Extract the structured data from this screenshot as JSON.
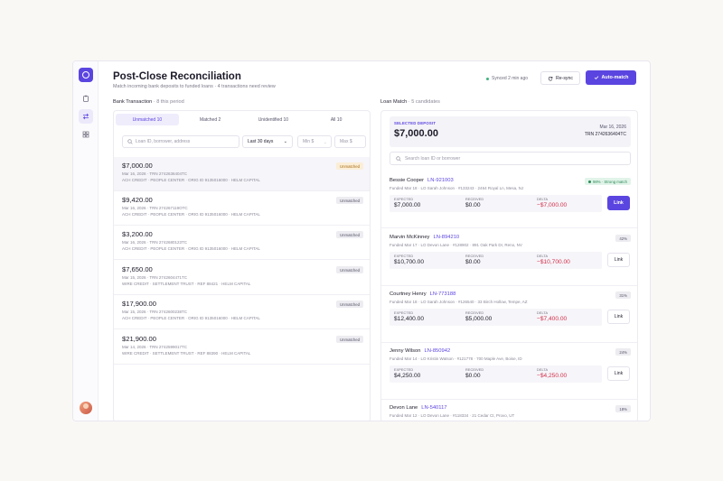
{
  "app": {
    "title": "Post-Close Reconciliation",
    "subtitle": "Match incoming bank deposits to funded loans · 4 transactions need review",
    "sync_status": "Synced 2 min ago",
    "resync_label": "Re-sync",
    "automatch_label": "Auto-match",
    "accent": "#5b45e0"
  },
  "rail": {
    "icons": [
      "logo-icon",
      "clipboard-icon",
      "swap-icon",
      "grid-icon"
    ]
  },
  "bank": {
    "heading": "Bank Transaction",
    "count": "· 8 this period",
    "tabs": [
      "Unmatched 10",
      "Matched 2",
      "Unidentified 10",
      "All 10"
    ],
    "search_placeholder": "Loan ID, borrower, address",
    "date_range": "Last 30 days",
    "min_placeholder": "Min $",
    "max_placeholder": "Max $",
    "transactions": [
      {
        "amount": "$7,000.00",
        "meta": "Mar 16, 2026 · TRN 2742636404TC",
        "meta2": "ACH CREDIT · PEOPLE CENTER · ORIG ID 9135016000 · HELM CAPITAL",
        "status": "Unmatched"
      },
      {
        "amount": "$9,420.00",
        "meta": "Mar 16, 2026 · TRN 274267119OTC",
        "meta2": "ACH CREDIT · PEOPLE CENTER · ORIG ID 9135016000 · HELM CAPITAL",
        "status": "Unmatched"
      },
      {
        "amount": "$3,200.00",
        "meta": "Mar 16, 2026 · TRN 2742680123TC",
        "meta2": "ACH CREDIT · PEOPLE CENTER · ORIG ID 9135016000 · HELM CAPITAL",
        "status": "Unmatched"
      },
      {
        "amount": "$7,650.00",
        "meta": "Mar 15, 2026 · TRN 2742604471TC",
        "meta2": "WIRE CREDIT · SETTLEMENT TRUST · REF 88421 · HELM CAPITAL",
        "status": "Unmatched"
      },
      {
        "amount": "$17,900.00",
        "meta": "Mar 15, 2026 · TRN 2742600238TC",
        "meta2": "ACH CREDIT · PEOPLE CENTER · ORIG ID 9135016000 · HELM CAPITAL",
        "status": "Unmatched"
      },
      {
        "amount": "$21,900.00",
        "meta": "Mar 14, 2026 · TRN 2742599017TC",
        "meta2": "WIRE CREDIT · SETTLEMENT TRUST · REF 88390 · HELM CAPITAL",
        "status": "Unmatched"
      }
    ]
  },
  "loan": {
    "heading": "Loan Match",
    "count": "· 5 candidates",
    "selected_label": "SELECTED DEPOSIT",
    "selected_amount": "$7,000.00",
    "selected_date": "Mar 16, 2026",
    "selected_trn": "TRN 2742636404TC",
    "search_placeholder": "Search loan ID or borrower",
    "col_expected": "EXPECTED",
    "col_received": "RECEIVED",
    "col_delta": "DELTA",
    "candidates": [
      {
        "name": "Bessie Cooper",
        "loan_id": "LN-921003",
        "sub": "Funded Mar 18 · LO Sarah Johnson · #133243 · 2464 Royal Ln, Mesa, NJ",
        "confidence": "98% · Strong match",
        "expected": "$7,000.00",
        "received": "$0.00",
        "delta": "−$7,000.00",
        "action": "Link"
      },
      {
        "name": "Marvin McKinney",
        "loan_id": "LN-894210",
        "sub": "Funded Mar 17 · LO Devon Lane · #128902 · 891 Oak Park Dr, Reno, NV",
        "confidence": "42%",
        "expected": "$10,700.00",
        "received": "$0.00",
        "delta": "−$10,700.00",
        "action": "Link"
      },
      {
        "name": "Courtney Henry",
        "loan_id": "LN-773188",
        "sub": "Funded Mar 18 · LO Sarah Johnson · #126540 · 33 Birch Hollow, Tempe, AZ",
        "confidence": "31%",
        "expected": "$12,400.00",
        "received": "$5,000.00",
        "delta": "−$7,400.00",
        "action": "Link"
      },
      {
        "name": "Jenny Wilson",
        "loan_id": "LN-850942",
        "sub": "Funded Mar 14 · LO Kristin Watson · #121778 · 700 Maple Ave, Boise, ID",
        "confidence": "24%",
        "expected": "$4,250.00",
        "received": "$0.00",
        "delta": "−$4,250.00",
        "action": "Link"
      },
      {
        "name": "Devon Lane",
        "loan_id": "LN-540117",
        "sub": "Funded Mar 12 · LO Devon Lane · #118334 · 21 Cedar Ct, Provo, UT",
        "confidence": "18%",
        "expected": "",
        "received": "",
        "delta": "",
        "action": ""
      }
    ]
  }
}
